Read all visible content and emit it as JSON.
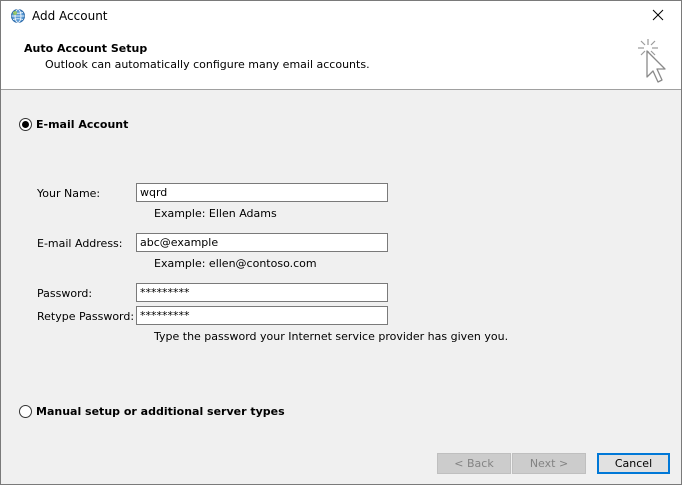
{
  "window": {
    "title": "Add Account"
  },
  "header": {
    "title": "Auto Account Setup",
    "subtitle": "Outlook can automatically configure many email accounts."
  },
  "options": {
    "email_account_label": "E-mail Account",
    "email_account_selected": true,
    "manual_setup_label": "Manual setup or additional server types",
    "manual_setup_selected": false
  },
  "form": {
    "name": {
      "label": "Your Name:",
      "value": "wqrd",
      "example": "Example: Ellen Adams"
    },
    "email": {
      "label": "E-mail Address:",
      "value": "abc@example",
      "example": "Example: ellen@contoso.com"
    },
    "password": {
      "label": "Password:",
      "value": "*********"
    },
    "retype_password": {
      "label": "Retype Password:",
      "value": "*********"
    },
    "password_hint": "Type the password your Internet service provider has given you."
  },
  "buttons": {
    "back": "< Back",
    "next": "Next >",
    "cancel": "Cancel"
  },
  "icons": {
    "app": "outlook-globe-icon",
    "close": "close-icon",
    "wizard": "sparkle-cursor-icon"
  },
  "colors": {
    "accent": "#0078d7",
    "header_bg": "#ffffff",
    "body_bg": "#f0f0f0"
  }
}
